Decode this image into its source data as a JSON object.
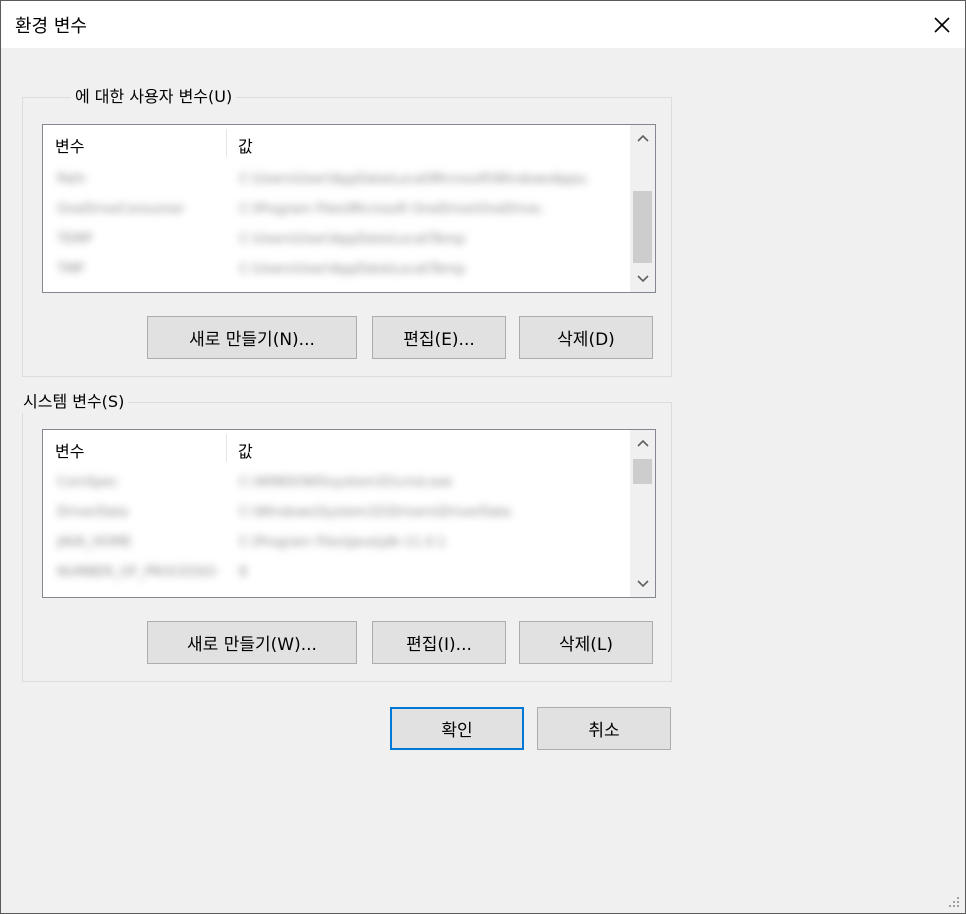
{
  "window": {
    "title": "환경 변수",
    "close_glyph": "✕"
  },
  "user_vars": {
    "legend": "에 대한 사용자 변수(U)",
    "col_name": "변수",
    "col_value": "값",
    "rows": [
      {
        "name": "Path",
        "value": "C:\\Users\\User\\AppData\\Local\\Microsoft\\WindowsApps;"
      },
      {
        "name": "OneDriveConsumer",
        "value": "C:\\Program Files\\Microsoft OneDrive\\OneDrive;"
      },
      {
        "name": "TEMP",
        "value": "C:\\Users\\User\\AppData\\Local\\Temp"
      },
      {
        "name": "TMP",
        "value": "C:\\Users\\User\\AppData\\Local\\Temp"
      }
    ],
    "buttons": {
      "new": "새로 만들기(N)...",
      "edit": "편집(E)...",
      "delete": "삭제(D)"
    }
  },
  "system_vars": {
    "legend": "시스템 변수(S)",
    "col_name": "변수",
    "col_value": "값",
    "rows": [
      {
        "name": "ComSpec",
        "value": "C:\\WINDOWS\\system32\\cmd.exe"
      },
      {
        "name": "DriverData",
        "value": "C:\\Windows\\System32\\Drivers\\DriverData"
      },
      {
        "name": "JAVA_HOME",
        "value": "C:\\Program Files\\Java\\jdk-11.0.1"
      },
      {
        "name": "NUMBER_OF_PROCESSORS",
        "value": "8"
      }
    ],
    "buttons": {
      "new": "새로 만들기(W)...",
      "edit": "편집(I)...",
      "delete": "삭제(L)"
    }
  },
  "footer": {
    "ok": "확인",
    "cancel": "취소"
  },
  "colors": {
    "accent": "#0078d7",
    "button_bg": "#e1e1e1",
    "dialog_bg": "#f0f0f0"
  }
}
